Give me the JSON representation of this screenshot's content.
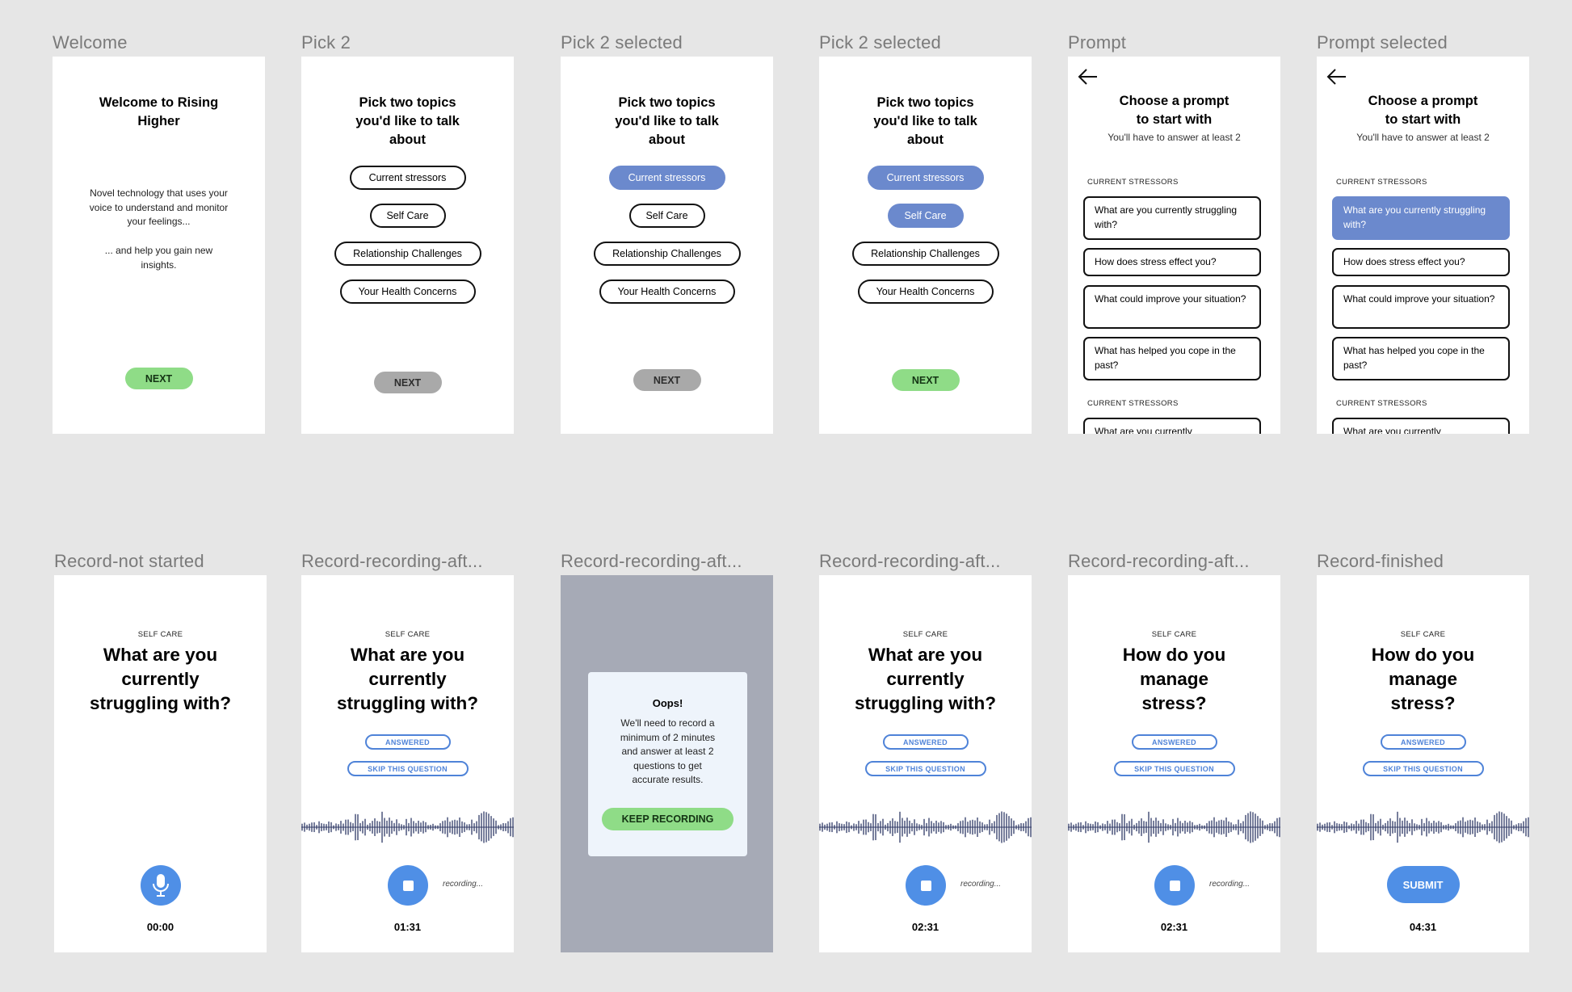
{
  "frames": [
    {
      "label": "Welcome",
      "title": "Welcome to Rising Higher",
      "body1": "Novel technology that uses your voice to understand and monitor your feelings...",
      "body2": "... and help you gain new insights.",
      "button": "NEXT"
    },
    {
      "label": "Pick 2",
      "title": "Pick two topics you'd like to talk about",
      "topics": [
        "Current stressors",
        "Self Care",
        "Relationship Challenges",
        "Your Health Concerns"
      ],
      "button": "NEXT",
      "selected_count": 0
    },
    {
      "label": "Pick 2 selected",
      "title": "Pick two topics you'd like to talk about",
      "topics": [
        "Current stressors",
        "Self Care",
        "Relationship Challenges",
        "Your Health Concerns"
      ],
      "button": "NEXT",
      "selected_count": 1
    },
    {
      "label": "Pick 2 selected",
      "title": "Pick two topics you'd like to talk about",
      "topics": [
        "Current stressors",
        "Self Care",
        "Relationship Challenges",
        "Your Health Concerns"
      ],
      "button": "NEXT",
      "selected_count": 2
    },
    {
      "label": "Prompt",
      "title": "Choose a prompt to start with",
      "subtitle": "You'll have to answer at least 2",
      "section": "CURRENT STRESSORS",
      "prompts": [
        "What are you currently struggling with?",
        "How does stress effect you?",
        "What could improve your situation?",
        "What has helped you cope in the past?"
      ],
      "section2": "CURRENT STRESSORS",
      "partial_prompt": "What are you currently"
    },
    {
      "label": "Prompt selected",
      "title": "Choose a prompt to start with",
      "subtitle": "You'll have to answer at least 2",
      "section": "CURRENT STRESSORS",
      "prompts": [
        "What are you currently struggling with?",
        "How does stress effect you?",
        "What could improve your situation?",
        "What has helped you cope in the past?"
      ],
      "section2": "CURRENT STRESSORS",
      "partial_prompt": "What are you currently"
    },
    {
      "label": "Record-not started",
      "category": "SELF CARE",
      "question": "What are you currently struggling with?",
      "timer": "00:00"
    },
    {
      "label": "Record-recording-aft...",
      "category": "SELF CARE",
      "question": "What are you currently struggling with?",
      "answered": "ANSWERED",
      "skip": "SKIP THIS QUESTION",
      "recording": "recording...",
      "timer": "01:31"
    },
    {
      "label": "Record-recording-aft...",
      "modal_title": "Oops!",
      "modal_body": "We'll need to record a minimum of 2 minutes and answer at least 2 questions to get accurate results.",
      "modal_button": "KEEP RECORDING"
    },
    {
      "label": "Record-recording-aft...",
      "category": "SELF CARE",
      "question": "What are you currently struggling with?",
      "answered": "ANSWERED",
      "skip": "SKIP THIS QUESTION",
      "recording": "recording...",
      "timer": "02:31"
    },
    {
      "label": "Record-recording-aft...",
      "category": "SELF CARE",
      "question": "How do you manage stress?",
      "answered": "ANSWERED",
      "skip": "SKIP THIS QUESTION",
      "recording": "recording...",
      "timer": "02:31"
    },
    {
      "label": "Record-finished",
      "category": "SELF CARE",
      "question": "How do you manage stress?",
      "answered": "ANSWERED",
      "skip": "SKIP THIS QUESTION",
      "submit": "SUBMIT",
      "timer": "04:31"
    }
  ],
  "colors": {
    "canvas": "#e6e6e6",
    "selected": "#6b89cd",
    "accent_blue": "#4f8fe6",
    "next_green": "#8fdc87",
    "next_disabled": "#a9a9a9",
    "overlay": "#a6aab6"
  }
}
